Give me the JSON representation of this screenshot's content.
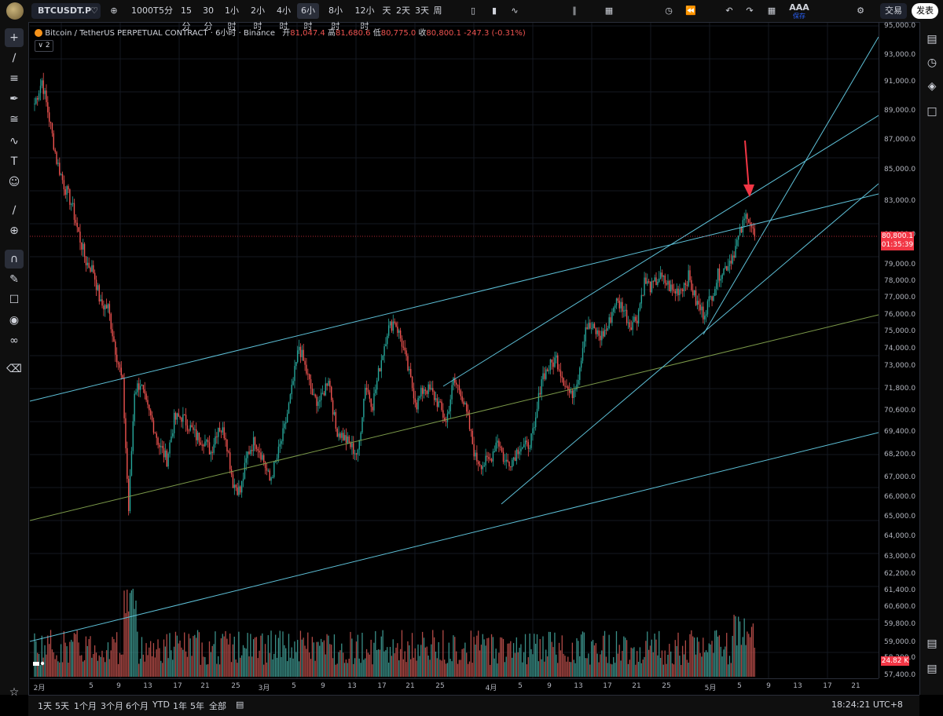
{
  "topbar": {
    "symbol": "BTCUSDT.P",
    "intervals": [
      "1000T",
      "5分",
      "15分",
      "30分",
      "1小时",
      "2小时",
      "4小时",
      "6小时",
      "8小时",
      "12小时",
      "天",
      "2天",
      "3天",
      "周"
    ],
    "active_interval": "6小时",
    "save_label": "AAA",
    "save_sub": "保存",
    "trade_label": "交易",
    "publish_label": "发表"
  },
  "legend": {
    "title": "Bitcoin / TetherUS PERPETUAL CONTRACT · 6小时 · Binance",
    "open_label": "开",
    "open": "81,047.4",
    "high_label": "高",
    "high": "81,680.6",
    "low_label": "低",
    "low": "80,775.0",
    "close_label": "收",
    "close": "80,800.1",
    "change": "-247.3 (-0.31%)",
    "collapse_count": "2"
  },
  "price_badge": {
    "price": "80,800.1",
    "countdown": "01:35:39"
  },
  "volume_badge": "24.82 K",
  "bottombar": {
    "ranges": [
      "1天",
      "5天",
      "1个月",
      "3个月",
      "6个月",
      "YTD",
      "1年",
      "5年",
      "全部"
    ],
    "clock": "18:24:21 UTC+8"
  },
  "colors": {
    "up": "#26a69a",
    "down": "#ef5350",
    "line": "#5ec1d8",
    "midline": "#7c9a4a",
    "arrow": "#f23645"
  },
  "chart_data": {
    "type": "candlestick",
    "symbol": "BTCUSDT.P",
    "interval": "6小时",
    "y_ticks": [
      "95,000.0",
      "93,000.0",
      "91,000.0",
      "89,000.0",
      "87,000.0",
      "85,000.0",
      "83,000.0",
      "81,000.0",
      "79,000.0",
      "78,000.0",
      "77,000.0",
      "76,000.0",
      "75,000.0",
      "74,000.0",
      "73,000.0",
      "71,800.0",
      "70,600.0",
      "69,400.0",
      "68,200.0",
      "67,000.0",
      "66,000.0",
      "65,000.0",
      "64,000.0",
      "63,000.0",
      "62,200.0",
      "61,400.0",
      "60,600.0",
      "59,800.0",
      "59,000.0",
      "58,200.0",
      "57,400.0"
    ],
    "x_ticks": [
      "2月",
      "5",
      "9",
      "13",
      "17",
      "21",
      "25",
      "3月",
      "5",
      "9",
      "13",
      "17",
      "21",
      "25",
      "4月",
      "5",
      "9",
      "13",
      "17",
      "21",
      "25",
      "5月",
      "5",
      "9",
      "13",
      "17",
      "21"
    ],
    "anchors": [
      [
        0,
        89500
      ],
      [
        5,
        91000
      ],
      [
        10,
        88500
      ],
      [
        15,
        85800
      ],
      [
        20,
        84200
      ],
      [
        25,
        83000
      ],
      [
        30,
        81000
      ],
      [
        35,
        79200
      ],
      [
        40,
        78600
      ],
      [
        45,
        76400
      ],
      [
        50,
        76200
      ],
      [
        55,
        73500
      ],
      [
        60,
        71200
      ],
      [
        64,
        63000
      ],
      [
        68,
        70800
      ],
      [
        72,
        71300
      ],
      [
        76,
        69800
      ],
      [
        80,
        68800
      ],
      [
        85,
        67200
      ],
      [
        90,
        66300
      ],
      [
        95,
        68900
      ],
      [
        100,
        69100
      ],
      [
        105,
        68500
      ],
      [
        110,
        67800
      ],
      [
        115,
        67600
      ],
      [
        120,
        66800
      ],
      [
        125,
        68500
      ],
      [
        130,
        67900
      ],
      [
        135,
        64800
      ],
      [
        140,
        64200
      ],
      [
        145,
        66700
      ],
      [
        150,
        67600
      ],
      [
        155,
        66500
      ],
      [
        160,
        64900
      ],
      [
        165,
        66400
      ],
      [
        170,
        68300
      ],
      [
        175,
        70800
      ],
      [
        180,
        73700
      ],
      [
        185,
        72000
      ],
      [
        190,
        70200
      ],
      [
        195,
        70200
      ],
      [
        200,
        71700
      ],
      [
        205,
        68300
      ],
      [
        210,
        67800
      ],
      [
        215,
        67200
      ],
      [
        220,
        66600
      ],
      [
        225,
        71200
      ],
      [
        230,
        69900
      ],
      [
        235,
        72400
      ],
      [
        240,
        74700
      ],
      [
        245,
        75400
      ],
      [
        250,
        73900
      ],
      [
        255,
        71800
      ],
      [
        260,
        69900
      ],
      [
        265,
        71000
      ],
      [
        270,
        70700
      ],
      [
        275,
        69900
      ],
      [
        280,
        68700
      ],
      [
        285,
        71400
      ],
      [
        290,
        70800
      ],
      [
        295,
        68800
      ],
      [
        300,
        66400
      ],
      [
        305,
        66000
      ],
      [
        310,
        66300
      ],
      [
        315,
        67700
      ],
      [
        320,
        66100
      ],
      [
        325,
        66300
      ],
      [
        330,
        67200
      ],
      [
        335,
        67100
      ],
      [
        340,
        68100
      ],
      [
        345,
        71700
      ],
      [
        350,
        72300
      ],
      [
        355,
        72900
      ],
      [
        360,
        71500
      ],
      [
        365,
        70400
      ],
      [
        370,
        71800
      ],
      [
        375,
        75000
      ],
      [
        380,
        74800
      ],
      [
        385,
        74300
      ],
      [
        390,
        74900
      ],
      [
        395,
        76600
      ],
      [
        400,
        76300
      ],
      [
        405,
        75100
      ],
      [
        410,
        75600
      ],
      [
        415,
        77900
      ],
      [
        420,
        77500
      ],
      [
        425,
        78200
      ],
      [
        430,
        77800
      ],
      [
        435,
        77200
      ],
      [
        440,
        77500
      ],
      [
        445,
        78200
      ],
      [
        450,
        76600
      ],
      [
        455,
        75800
      ],
      [
        460,
        76800
      ],
      [
        465,
        78300
      ],
      [
        470,
        78800
      ],
      [
        475,
        79600
      ],
      [
        480,
        81000
      ],
      [
        485,
        82400
      ],
      [
        490,
        80800
      ]
    ],
    "volume_note": "vertical volume bars along bottom in up/down colors"
  }
}
